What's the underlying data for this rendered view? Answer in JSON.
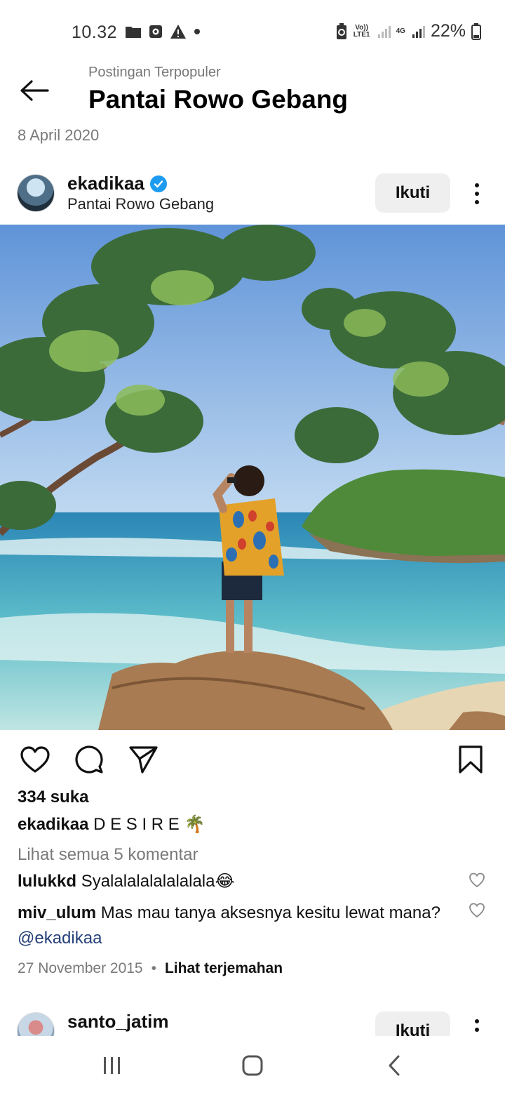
{
  "status_bar": {
    "time": "10.32",
    "battery": "22%",
    "network_label": "4G",
    "volte_label": "Vo)) LTE1"
  },
  "header": {
    "subtitle": "Postingan Terpopuler",
    "title": "Pantai Rowo Gebang",
    "date": "8 April 2020"
  },
  "post": {
    "username": "ekadikaa",
    "location": "Pantai Rowo Gebang",
    "follow_label": "Ikuti",
    "likes": "334 suka",
    "caption_user": "ekadikaa",
    "caption_text": "D E S I R E 🌴",
    "view_comments": "Lihat semua 5 komentar",
    "comments": [
      {
        "user": "lulukkd",
        "text": "Syalalalalalalalala😂"
      },
      {
        "user": "miv_ulum",
        "text": "Mas mau tanya aksesnya kesitu lewat mana?",
        "mention": "@ekadikaa"
      }
    ],
    "date": "27 November 2015",
    "separator": "•",
    "translate_label": "Lihat terjemahan"
  },
  "next_post": {
    "username": "santo_jatim",
    "follow_label": "Ikuti"
  },
  "icons": {
    "back": "arrow-left-icon",
    "like": "heart-icon",
    "comment": "comment-icon",
    "share": "send-icon",
    "save": "bookmark-icon",
    "verified": "verified-badge-icon",
    "more": "more-vertical-icon"
  },
  "colors": {
    "verified": "#1d9bf0",
    "mention": "#24407a",
    "follow_bg": "#efefef",
    "muted_text": "#7a7a7a"
  }
}
